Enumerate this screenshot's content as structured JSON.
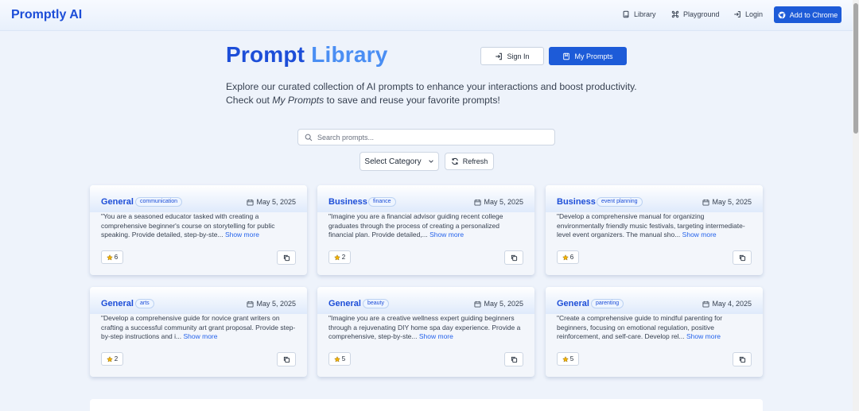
{
  "header": {
    "brand": "Promptly AI",
    "nav": [
      {
        "label": "Library",
        "icon": "book-icon"
      },
      {
        "label": "Playground",
        "icon": "command-icon"
      },
      {
        "label": "Login",
        "icon": "login-icon"
      }
    ],
    "chrome_button": "Add to Chrome"
  },
  "hero": {
    "title_word1": "Prompt",
    "title_word2": "Library",
    "signin_label": "Sign In",
    "my_prompts_label": "My Prompts",
    "intro_before": "Explore our curated collection of AI prompts to enhance your interactions and boost productivity. Check out ",
    "intro_em": "My Prompts",
    "intro_after": " to save and reuse your favorite prompts!"
  },
  "search": {
    "placeholder": "Search prompts..."
  },
  "filters": {
    "category_label": "Select Category",
    "refresh_label": "Refresh"
  },
  "cards": [
    {
      "category": "General",
      "tag": "communication",
      "date": "May 5, 2025",
      "description": "\"You are a seasoned educator tasked with creating a comprehensive beginner's course on storytelling for public speaking. Provide detailed, step-by-ste...",
      "more": "Show more",
      "stars": "6"
    },
    {
      "category": "Business",
      "tag": "finance",
      "date": "May 5, 2025",
      "description": "\"Imagine you are a financial advisor guiding recent college graduates through the process of creating a personalized financial plan. Provide detailed,...",
      "more": "Show more",
      "stars": "2"
    },
    {
      "category": "Business",
      "tag": "event planning",
      "date": "May 5, 2025",
      "description": "\"Develop a comprehensive manual for organizing environmentally friendly music festivals, targeting intermediate-level event organizers. The manual sho...",
      "more": "Show more",
      "stars": "6"
    },
    {
      "category": "General",
      "tag": "arts",
      "date": "May 5, 2025",
      "description": "\"Develop a comprehensive guide for novice grant writers on crafting a successful community art grant proposal. Provide step-by-step instructions and i...",
      "more": "Show more",
      "stars": "2"
    },
    {
      "category": "General",
      "tag": "beauty",
      "date": "May 5, 2025",
      "description": "\"Imagine you are a creative wellness expert guiding beginners through a rejuvenating DIY home spa day experience. Provide a comprehensive, step-by-ste...",
      "more": "Show more",
      "stars": "5"
    },
    {
      "category": "General",
      "tag": "parenting",
      "date": "May 4, 2025",
      "description": "\"Create a comprehensive guide to mindful parenting for beginners, focusing on emotional regulation, positive reinforcement, and self-care. Develop rel...",
      "more": "Show more",
      "stars": "5"
    }
  ]
}
